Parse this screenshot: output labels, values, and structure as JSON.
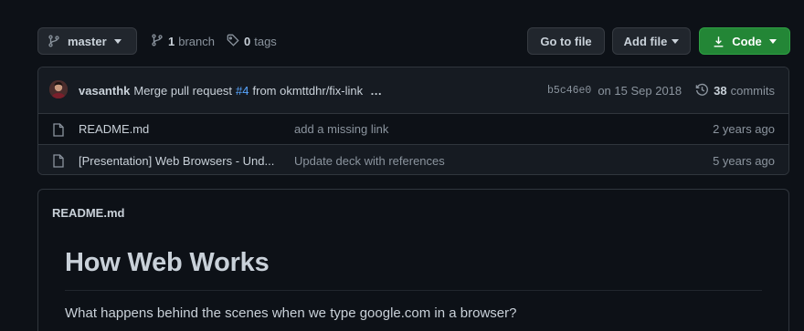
{
  "toolbar": {
    "branch_name": "master",
    "branches_count": "1",
    "branches_label": "branch",
    "tags_count": "0",
    "tags_label": "tags",
    "goto_file_label": "Go to file",
    "add_file_label": "Add file",
    "code_label": "Code",
    "code_button_color": "#238636"
  },
  "commit": {
    "author": "vasanthk",
    "message_prefix": "Merge pull request",
    "pr_number": "#4",
    "message_suffix": "from okmttdhr/fix-link",
    "ellipsis": "…",
    "sha": "b5c46e0",
    "date": "on 15 Sep 2018",
    "commits_count": "38",
    "commits_label": "commits",
    "link_color": "#58a6ff"
  },
  "files": [
    {
      "name": "README.md",
      "commit_message": "add a missing link",
      "age": "2 years ago",
      "icon": "file-icon"
    },
    {
      "name": "[Presentation] Web Browsers - Und...",
      "commit_message": "Update deck with references",
      "age": "5 years ago",
      "icon": "file-icon"
    }
  ],
  "readme": {
    "header": "README.md",
    "title": "How Web Works",
    "intro": "What happens behind the scenes when we type google.com in a browser?"
  }
}
